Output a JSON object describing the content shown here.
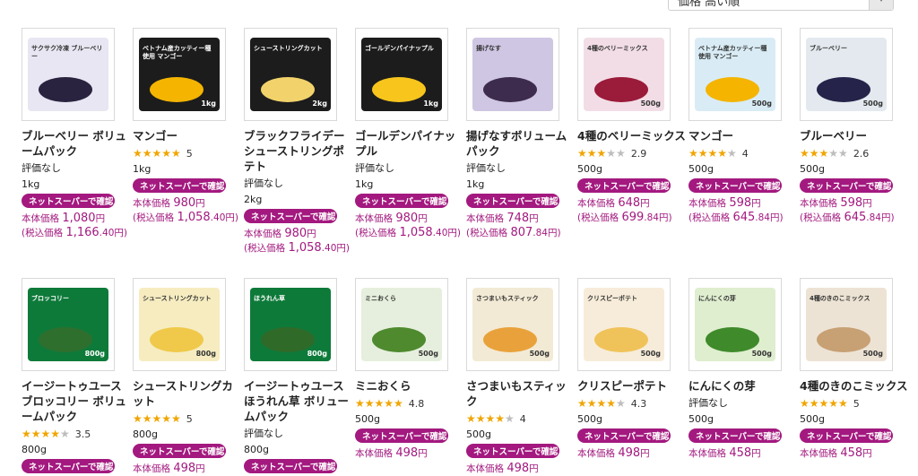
{
  "sort": {
    "label": "価格 高い順",
    "arrow": "▾"
  },
  "badge_label": "ネットスーパーで確認",
  "price_prefix": "本体価格",
  "tax_prefix": "(税込価格",
  "yen": "円",
  "row1": [
    {
      "name": "ブルーベリー ボリュームパック",
      "rating": null,
      "rating_text": "評価なし",
      "size": "1kg",
      "price": "1,080",
      "tax_price": "1,166",
      "tax_decimal": ".40",
      "pkg": {
        "color": "#e8e6f2",
        "title": "サクサク冷凍 ブルーベリー",
        "weight": "",
        "blob": "#2a2340",
        "title_color": "#333"
      }
    },
    {
      "name": "マンゴー",
      "stars": 5,
      "rating_num": "5",
      "size": "1kg",
      "price": "980",
      "tax_price": "1,058",
      "tax_decimal": ".40",
      "pkg": {
        "color": "#1c1c1c",
        "title": "ベトナム産カッティー種使用 マンゴー",
        "weight": "1kg",
        "blob": "#f4b400",
        "title_color": "#fff"
      }
    },
    {
      "name": "ブラックフライデーシューストリングポテト",
      "rating": null,
      "rating_text": "評価なし",
      "size": "2kg",
      "price": "980",
      "tax_price": "1,058",
      "tax_decimal": ".40",
      "pkg": {
        "color": "#1c1c1c",
        "title": "シューストリングカット",
        "weight": "2kg",
        "blob": "#f2d36b",
        "title_color": "#fff"
      }
    },
    {
      "name": "ゴールデンパイナップル",
      "rating": null,
      "rating_text": "評価なし",
      "size": "1kg",
      "price": "980",
      "tax_price": "1,058",
      "tax_decimal": ".40",
      "pkg": {
        "color": "#1c1c1c",
        "title": "ゴールデンパイナップル",
        "weight": "1kg",
        "blob": "#f7c51c",
        "title_color": "#fff"
      }
    },
    {
      "name": "揚げなすボリュームパック",
      "rating": null,
      "rating_text": "評価なし",
      "size": "1kg",
      "price": "748",
      "tax_price": "807",
      "tax_decimal": ".84",
      "pkg": {
        "color": "#cfc6e3",
        "title": "揚げなす",
        "weight": "",
        "blob": "#3d2c4d",
        "title_color": "#333"
      }
    },
    {
      "name": "4種のベリーミックス",
      "stars": 2.9,
      "rating_num": "2.9",
      "size": "500g",
      "price": "648",
      "tax_price": "699",
      "tax_decimal": ".84",
      "pkg": {
        "color": "#f2dde6",
        "title": "4種のベリーミックス",
        "weight": "500g",
        "blob": "#9b1b3a",
        "title_color": "#333"
      }
    },
    {
      "name": "マンゴー",
      "stars": 4,
      "rating_num": "4",
      "size": "500g",
      "price": "598",
      "tax_price": "645",
      "tax_decimal": ".84",
      "pkg": {
        "color": "#d9ecf5",
        "title": "ベトナム産カッティー種使用 マンゴー",
        "weight": "500g",
        "blob": "#f4b400",
        "title_color": "#333"
      }
    },
    {
      "name": "ブルーベリー",
      "stars": 2.6,
      "rating_num": "2.6",
      "size": "500g",
      "price": "598",
      "tax_price": "645",
      "tax_decimal": ".84",
      "pkg": {
        "color": "#e3e9ee",
        "title": "ブルーベリー",
        "weight": "500g",
        "blob": "#25234a",
        "title_color": "#333"
      }
    }
  ],
  "row2": [
    {
      "name": "イージートゥユースブロッコリー ボリュームパック",
      "stars": 3.5,
      "rating_num": "3.5",
      "size": "800g",
      "pkg": {
        "color": "#0e7a3a",
        "title": "ブロッコリー",
        "weight": "800g",
        "blob": "#2e6f2e",
        "title_color": "#fff"
      }
    },
    {
      "name": "シューストリングカット",
      "stars": 5,
      "rating_num": "5",
      "size": "800g",
      "price": "498",
      "pkg": {
        "color": "#f6ecc0",
        "title": "シューストリングカット",
        "weight": "800g",
        "blob": "#f0c94a",
        "title_color": "#333"
      }
    },
    {
      "name": "イージートゥユースほうれん草 ボリュームパック",
      "rating": null,
      "rating_text": "評価なし",
      "size": "800g",
      "pkg": {
        "color": "#0e7a3a",
        "title": "ほうれん草",
        "weight": "800g",
        "blob": "#2f6a28",
        "title_color": "#fff"
      }
    },
    {
      "name": "ミニおくら",
      "stars": 4.8,
      "rating_num": "4.8",
      "size": "500g",
      "price": "498",
      "pkg": {
        "color": "#e6efdd",
        "title": "ミニおくら",
        "weight": "500g",
        "blob": "#4f8a2f",
        "title_color": "#333"
      }
    },
    {
      "name": "さつまいもスティック",
      "stars": 4,
      "rating_num": "4",
      "size": "500g",
      "price": "498",
      "pkg": {
        "color": "#f3ead5",
        "title": "さつまいもスティック",
        "weight": "500g",
        "blob": "#e9a23b",
        "title_color": "#333"
      }
    },
    {
      "name": "クリスピーポテト",
      "stars": 4.3,
      "rating_num": "4.3",
      "size": "500g",
      "price": "498",
      "pkg": {
        "color": "#f7ecd9",
        "title": "クリスピーポテト",
        "weight": "500g",
        "blob": "#f0c35a",
        "title_color": "#333"
      }
    },
    {
      "name": "にんにくの芽",
      "rating": null,
      "rating_text": "評価なし",
      "size": "500g",
      "price": "458",
      "pkg": {
        "color": "#dfeecf",
        "title": "にんにくの芽",
        "weight": "500g",
        "blob": "#3f8a2b",
        "title_color": "#333"
      }
    },
    {
      "name": "4種のきのこミックス",
      "stars": 5,
      "rating_num": "5",
      "size": "500g",
      "price": "458",
      "pkg": {
        "color": "#ede3d4",
        "title": "4種のきのこミックス",
        "weight": "500g",
        "blob": "#c7a074",
        "title_color": "#333"
      }
    }
  ]
}
